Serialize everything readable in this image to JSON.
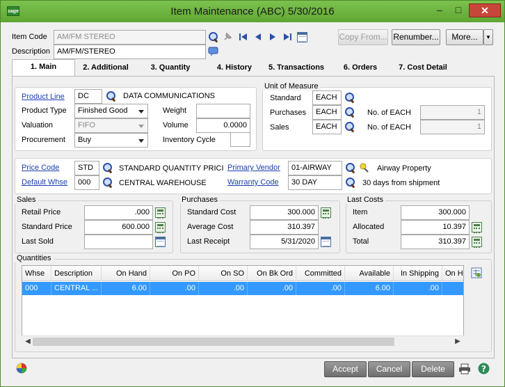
{
  "window": {
    "title": "Item Maintenance (ABC) 5/30/2016",
    "logo": "sage"
  },
  "header": {
    "item_code_label": "Item Code",
    "item_code_value": "AM/FM STEREO",
    "description_label": "Description",
    "description_value": "AM/FM/STEREO",
    "copy_from": "Copy From...",
    "renumber": "Renumber...",
    "more": "More..."
  },
  "tabs": [
    {
      "label": "1. Main"
    },
    {
      "label": "2. Additional"
    },
    {
      "label": "3. Quantity"
    },
    {
      "label": "4. History"
    },
    {
      "label": "5. Transactions"
    },
    {
      "label": "6. Orders"
    },
    {
      "label": "7. Cost Detail"
    }
  ],
  "main": {
    "product_line_label": "Product Line",
    "product_line_value": "DC",
    "product_line_desc": "DATA COMMUNICATIONS",
    "product_type_label": "Product Type",
    "product_type_value": "Finished Good",
    "valuation_label": "Valuation",
    "valuation_value": "FIFO",
    "procurement_label": "Procurement",
    "procurement_value": "Buy",
    "weight_label": "Weight",
    "weight_value": "",
    "volume_label": "Volume",
    "volume_value": "0.0000",
    "inventory_cycle_label": "Inventory Cycle",
    "inventory_cycle_value": ""
  },
  "uom": {
    "title": "Unit of Measure",
    "standard_label": "Standard",
    "standard_value": "EACH",
    "purchases_label": "Purchases",
    "purchases_value": "EACH",
    "sales_label": "Sales",
    "sales_value": "EACH",
    "no_of_purchases_label": "No. of  EACH",
    "no_of_purchases_value": "1",
    "no_of_sales_label": "No. of  EACH",
    "no_of_sales_value": "1"
  },
  "codes": {
    "price_code_label": "Price Code",
    "price_code_value": "STD",
    "price_code_desc": "STANDARD QUANTITY PRICING",
    "default_whse_label": "Default Whse",
    "default_whse_value": "000",
    "default_whse_desc": "CENTRAL WAREHOUSE",
    "primary_vendor_label": "Primary Vendor",
    "primary_vendor_value": "01-AIRWAY",
    "primary_vendor_desc": "Airway Property",
    "warranty_code_label": "Warranty Code",
    "warranty_code_value": "30 DAY",
    "warranty_code_desc": "30 days from shipment"
  },
  "sales": {
    "title": "Sales",
    "retail_price_label": "Retail Price",
    "retail_price_value": ".000",
    "standard_price_label": "Standard Price",
    "standard_price_value": "600.000",
    "last_sold_label": "Last Sold",
    "last_sold_value": ""
  },
  "purchases": {
    "title": "Purchases",
    "standard_cost_label": "Standard Cost",
    "standard_cost_value": "300.000",
    "average_cost_label": "Average Cost",
    "average_cost_value": "310.397",
    "last_receipt_label": "Last Receipt",
    "last_receipt_value": "5/31/2020"
  },
  "last_costs": {
    "title": "Last Costs",
    "item_label": "Item",
    "item_value": "300.000",
    "allocated_label": "Allocated",
    "allocated_value": "10.397",
    "total_label": "Total",
    "total_value": "310.397"
  },
  "quantities": {
    "title": "Quantities",
    "columns": [
      "Whse",
      "Description",
      "On Hand",
      "On PO",
      "On SO",
      "On Bk Ord",
      "Committed",
      "Available",
      "In Shipping",
      "On H"
    ],
    "rows": [
      [
        "000",
        "CENTRAL ...",
        "6.00",
        ".00",
        ".00",
        ".00",
        ".00",
        "6.00",
        ".00",
        ""
      ]
    ]
  },
  "footer": {
    "accept": "Accept",
    "cancel": "Cancel",
    "delete": "Delete"
  }
}
